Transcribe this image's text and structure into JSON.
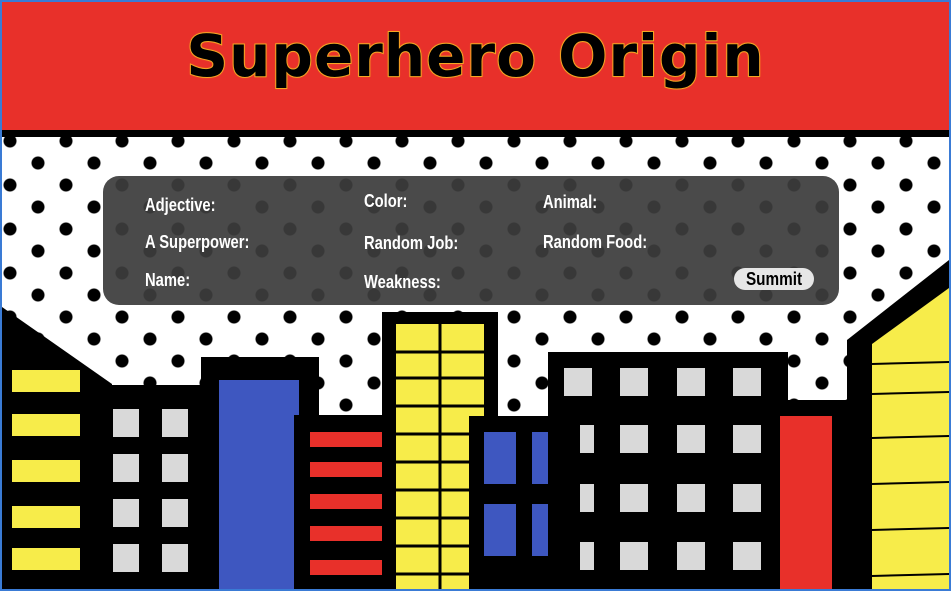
{
  "header": {
    "title": "Superhero Origin"
  },
  "form": {
    "fields": [
      {
        "label": "Adjective:"
      },
      {
        "label": "Color:"
      },
      {
        "label": "Animal:"
      },
      {
        "label": "A Superpower:"
      },
      {
        "label": "Random Job:"
      },
      {
        "label": "Random Food:"
      },
      {
        "label": "Name:"
      },
      {
        "label": "Weakness:"
      }
    ],
    "submit_label": "Summit"
  },
  "colors": {
    "header_red": "#e8302a",
    "title_outline": "#f5a623",
    "building_yellow": "#f7ec4a",
    "building_blue": "#3e57c0",
    "building_red": "#e8302a",
    "window_gray": "#d9d9d9",
    "frame_blue": "#3a7bd5"
  }
}
